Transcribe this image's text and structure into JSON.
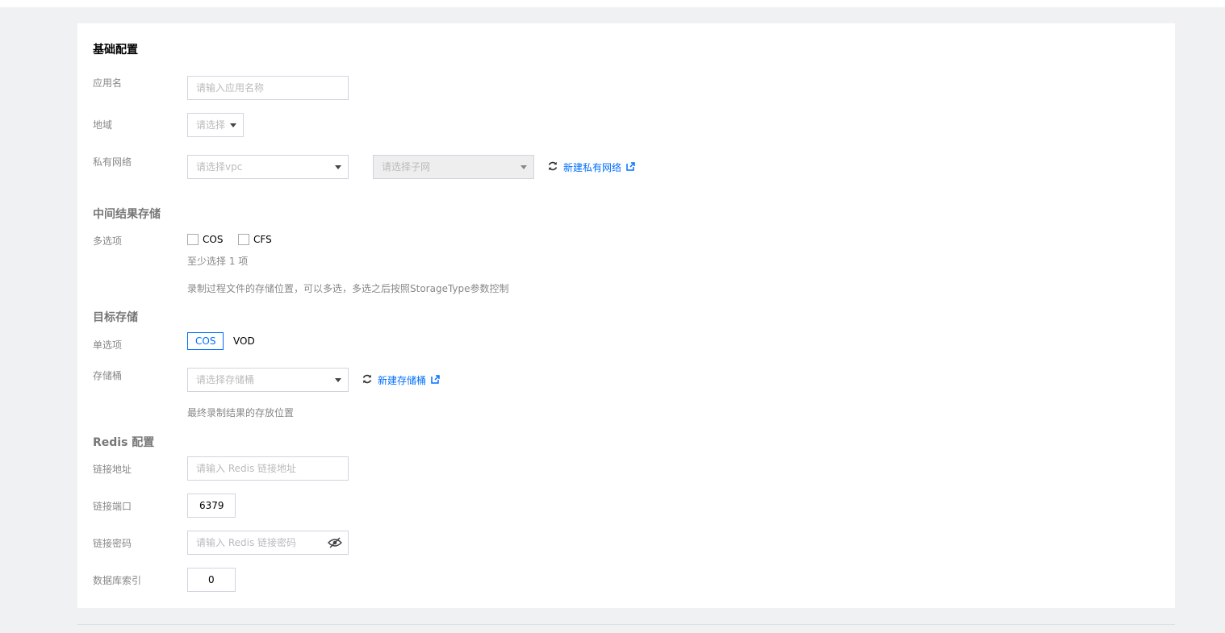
{
  "colors": {
    "accent": "#006eff",
    "page_bg": "#f0f1f3",
    "label": "#888888"
  },
  "sections": {
    "basic": {
      "title": "基础配置",
      "app_name": {
        "label": "应用名",
        "placeholder": "请输入应用名称"
      },
      "region": {
        "label": "地域",
        "placeholder": "请选择"
      },
      "vpc": {
        "label": "私有网络",
        "vpc_placeholder": "请选择vpc",
        "subnet_placeholder": "请选择子网",
        "create_link": "新建私有网络"
      }
    },
    "intermediate": {
      "title": "中间结果存储",
      "label": "多选项",
      "options": [
        "COS",
        "CFS"
      ],
      "hint_min": "至少选择 1 项",
      "description": "录制过程文件的存储位置，可以多选，多选之后按照StorageType参数控制"
    },
    "target": {
      "title": "目标存储",
      "label": "单选项",
      "options": [
        "COS",
        "VOD"
      ],
      "selected": "COS",
      "bucket": {
        "label": "存储桶",
        "placeholder": "请选择存储桶",
        "create_link": "新建存储桶"
      },
      "description": "最终录制结果的存放位置"
    },
    "redis": {
      "title": "Redis 配置",
      "address": {
        "label": "链接地址",
        "placeholder": "请输入 Redis 链接地址"
      },
      "port": {
        "label": "链接端口",
        "value": "6379"
      },
      "password": {
        "label": "链接密码",
        "placeholder": "请输入 Redis 链接密码"
      },
      "db_index": {
        "label": "数据库索引",
        "value": "0"
      }
    }
  },
  "icons": {
    "refresh": "refresh-icon",
    "external": "external-link-icon",
    "eye_off": "eye-off-icon",
    "caret": "caret-down-icon"
  }
}
